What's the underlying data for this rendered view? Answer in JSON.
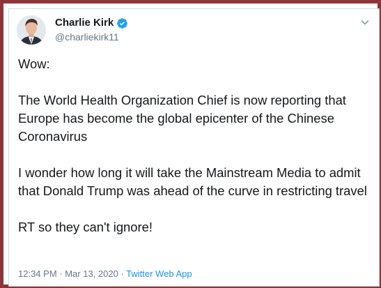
{
  "author": {
    "display_name": "Charlie Kirk",
    "handle": "@charliekirk11",
    "verified": true
  },
  "tweet": {
    "paragraphs": [
      "Wow:",
      "The World Health Organization Chief is now reporting that Europe has become the global epicenter of the Chinese Coronavirus",
      "I wonder how long it will take the Mainstream Media to admit that Donald Trump was ahead of the curve in restricting travel",
      "RT so they can't ignore!"
    ]
  },
  "meta": {
    "time": "12:34 PM",
    "separator1": " · ",
    "date": "Mar 13, 2020",
    "separator2": " · ",
    "source": "Twitter Web App"
  },
  "colors": {
    "frame": "#8e3438",
    "text": "#14171a",
    "secondary": "#657786",
    "link": "#1b95e0",
    "verified": "#1da1f2"
  },
  "icons": {
    "verified": "verified-badge-icon",
    "menu": "chevron-down-icon"
  }
}
